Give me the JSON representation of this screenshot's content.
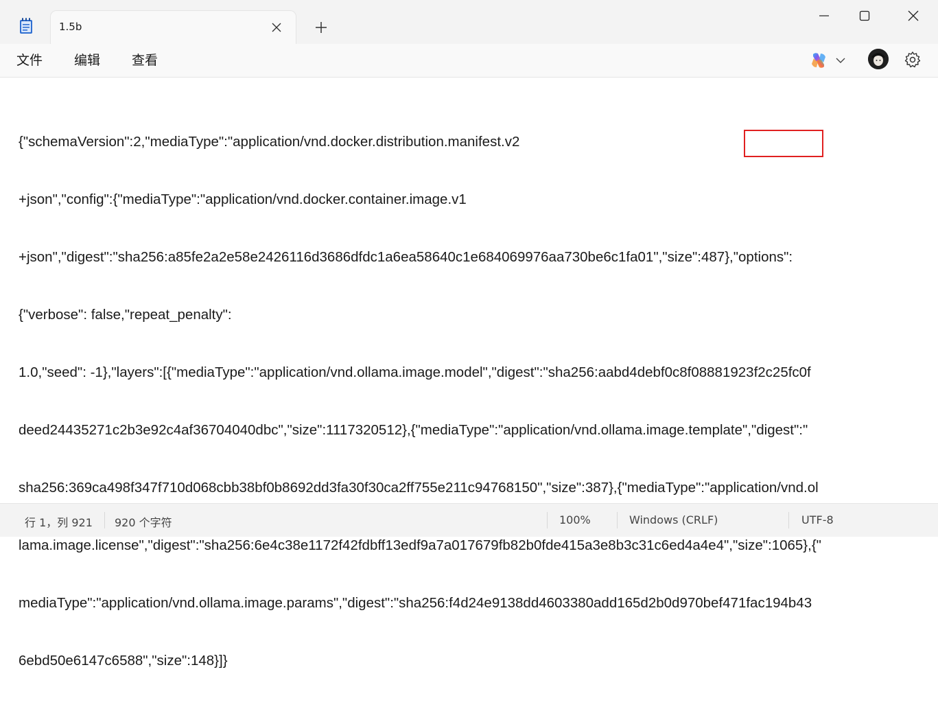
{
  "window": {
    "tab_title": "1.5b",
    "new_tab_symbol": "+",
    "icons": {
      "app": "notepad-icon",
      "tab_close": "close-icon",
      "minimize": "minimize-icon",
      "maximize": "maximize-icon",
      "close": "close-icon"
    }
  },
  "menu": {
    "file": "文件",
    "edit": "编辑",
    "view": "查看",
    "icons": {
      "copilot": "copilot-icon",
      "dropdown": "chevron-down-icon",
      "avatar": "avatar",
      "settings": "gear-icon"
    }
  },
  "editor": {
    "lines": [
      "{\"schemaVersion\":2,\"mediaType\":\"application/vnd.docker.distribution.manifest.v2",
      "+json\",\"config\":{\"mediaType\":\"application/vnd.docker.container.image.v1",
      "+json\",\"digest\":\"sha256:a85fe2a2e58e2426116d3686dfdc1a6ea58640c1e684069976aa730be6c1fa01\",\"size\":487},\"options\":",
      "{\"verbose\": false,\"repeat_penalty\":",
      "1.0,\"seed\": -1},\"layers\":[{\"mediaType\":\"application/vnd.ollama.image.model\",\"digest\":\"sha256:aabd4debf0c8f08881923f2c25fc0f",
      "deed24435271c2b3e92c4af36704040dbc\",\"size\":1117320512},{\"mediaType\":\"application/vnd.ollama.image.template\",\"digest\":\"",
      "sha256:369ca498f347f710d068cbb38bf0b8692dd3fa30f30ca2ff755e211c94768150\",\"size\":387},{\"mediaType\":\"application/vnd.ol",
      "lama.image.license\",\"digest\":\"sha256:6e4c38e1172f42fdbff13edf9a7a017679fb82b0fde415a3e8b3c31c6ed4a4e4\",\"size\":1065},{\"",
      "mediaType\":\"application/vnd.ollama.image.params\",\"digest\":\"sha256:f4d24e9138dd4603380add165d2b0d970bef471fac194b43",
      "6ebd50e6147c6588\",\"size\":148}]}"
    ],
    "highlight_color": "#e02020"
  },
  "status": {
    "position": "行 1，列 921",
    "char_count": "920 个字符",
    "zoom": "100%",
    "line_ending": "Windows (CRLF)",
    "encoding": "UTF-8"
  }
}
